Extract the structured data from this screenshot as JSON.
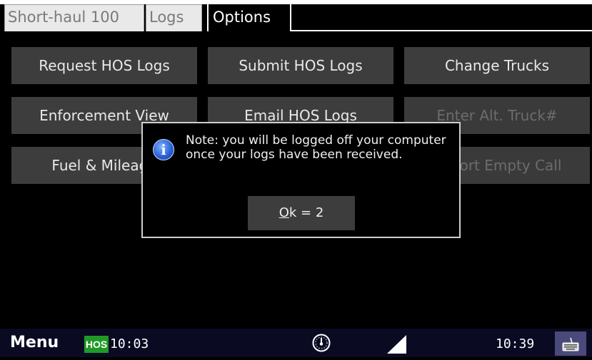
{
  "tabs": [
    {
      "label": "Short-haul 100",
      "active": false
    },
    {
      "label": "Logs",
      "active": false
    },
    {
      "label": "Options",
      "active": true
    }
  ],
  "buttons": [
    {
      "label": "Request HOS Logs",
      "enabled": true
    },
    {
      "label": "Submit HOS Logs",
      "enabled": true
    },
    {
      "label": "Change Trucks",
      "enabled": true
    },
    {
      "label": "Enforcement View",
      "enabled": true
    },
    {
      "label": "Email HOS Logs",
      "enabled": true
    },
    {
      "label": "Enter Alt. Truck#",
      "enabled": false
    },
    {
      "label": "Fuel & Mileage",
      "enabled": true
    },
    {
      "label": "",
      "enabled": true
    },
    {
      "label": "Report Empty Call",
      "enabled": false
    }
  ],
  "dialog": {
    "message": "Note: you will be logged off your computer once your logs have been received.",
    "ok_accel": "O",
    "ok_rest": "k = 2",
    "icon": "info-icon"
  },
  "statusbar": {
    "menu_label": "Menu",
    "hos_badge": "HOS",
    "hos_time": "10:03",
    "clock": "10:39",
    "icons": [
      "gauge-icon",
      "signal-icon",
      "keyboard-icon"
    ]
  },
  "colors": {
    "background": "#000000",
    "button": "#3d3d3d",
    "statusbar": "#0a0a23",
    "hos_badge": "#1f9a27",
    "info_icon": "#2a62d8"
  }
}
